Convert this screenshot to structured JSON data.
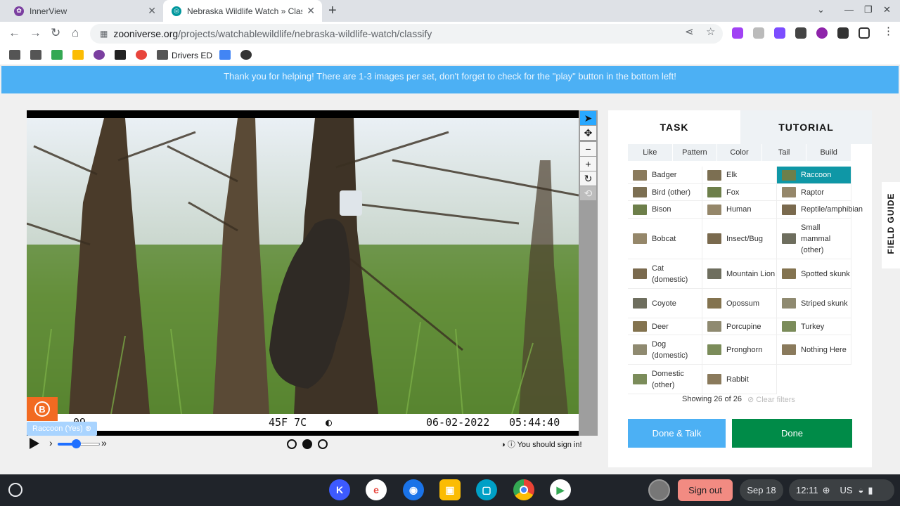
{
  "browser": {
    "tabs": [
      {
        "title": "InnerView",
        "favicon": "innerview-icon",
        "color": "#7b3fa0"
      },
      {
        "title": "Nebraska Wildlife Watch » Class",
        "favicon": "zooniverse-icon",
        "color": "#00979d"
      }
    ],
    "url_host": "zooniverse.org",
    "url_path": "/projects/watchablewildlife/nebraska-wildlife-watch/classify",
    "bookmarks": {
      "drivers_ed": "Drivers ED"
    }
  },
  "banner": {
    "text": "Thank you for helping! There are 1-3 images per set, don't forget to check for the \"play\" button in the bottom left!"
  },
  "viewer": {
    "stamp_left": "09",
    "stamp_temp": "45F 7C",
    "stamp_date": "06-02-2022",
    "stamp_time": "05:44:40",
    "subject_tag": "Raccoon (Yes)",
    "frames": 3,
    "active_frame": 2,
    "signin_text": "You should sign in!"
  },
  "panel": {
    "tab_task": "TASK",
    "tab_tutorial": "TUTORIAL",
    "filters": [
      "Like",
      "Pattern",
      "Color",
      "Tail",
      "Build"
    ],
    "species": [
      [
        "Badger",
        "Elk",
        "Raccoon"
      ],
      [
        "Bird (other)",
        "Fox",
        "Raptor"
      ],
      [
        "Bison",
        "Human",
        "Reptile/amphibian"
      ],
      [
        "Bobcat",
        "Insect/Bug",
        "Small mammal (other)"
      ],
      [
        "Cat (domestic)",
        "Mountain Lion",
        "Spotted skunk"
      ],
      [
        "Coyote",
        "Opossum",
        "Striped skunk"
      ],
      [
        "Deer",
        "Porcupine",
        "Turkey"
      ],
      [
        "Dog (domestic)",
        "Pronghorn",
        "Nothing Here"
      ],
      [
        "Domestic (other)",
        "Rabbit",
        ""
      ]
    ],
    "selected": "Raccoon",
    "showing": "Showing 26 of 26",
    "clear_filters": "Clear filters",
    "done_talk": "Done & Talk",
    "done": "Done",
    "field_guide": "FIELD GUIDE"
  },
  "shelf": {
    "sign_out": "Sign out",
    "date": "Sep 18",
    "time": "12:11",
    "locale": "US"
  }
}
